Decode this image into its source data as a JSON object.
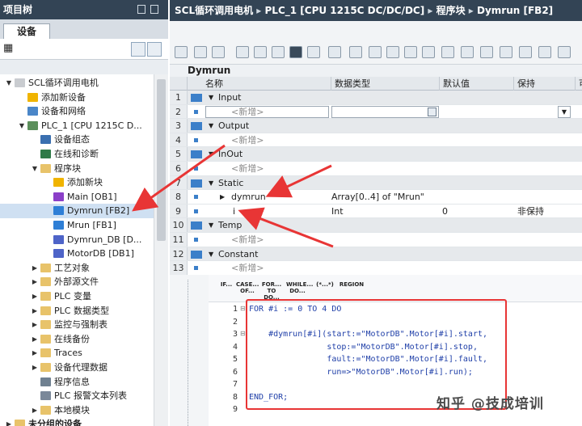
{
  "left_pane": {
    "title": "项目树",
    "tab": "设备"
  },
  "tree": [
    {
      "label": "SCL循环调用电机",
      "depth": 0,
      "expander": "▼",
      "icon": "project-icon"
    },
    {
      "label": "添加新设备",
      "depth": 1,
      "expander": "",
      "icon": "add-device-icon"
    },
    {
      "label": "设备和网络",
      "depth": 1,
      "expander": "",
      "icon": "network-icon"
    },
    {
      "label": "PLC_1 [CPU 1215C D...",
      "depth": 1,
      "expander": "▼",
      "icon": "plc-icon"
    },
    {
      "label": "设备组态",
      "depth": 2,
      "expander": "",
      "icon": "config-icon"
    },
    {
      "label": "在线和诊断",
      "depth": 2,
      "expander": "",
      "icon": "diag-icon"
    },
    {
      "label": "程序块",
      "depth": 2,
      "expander": "▼",
      "icon": "folder-icon"
    },
    {
      "label": "添加新块",
      "depth": 3,
      "expander": "",
      "icon": "add-block-icon"
    },
    {
      "label": "Main [OB1]",
      "depth": 3,
      "expander": "",
      "icon": "ob-icon"
    },
    {
      "label": "Dymrun [FB2]",
      "depth": 3,
      "expander": "",
      "icon": "fb-icon",
      "selected": true
    },
    {
      "label": "Mrun [FB1]",
      "depth": 3,
      "expander": "",
      "icon": "fb-icon"
    },
    {
      "label": "Dymrun_DB [D...",
      "depth": 3,
      "expander": "",
      "icon": "db-icon"
    },
    {
      "label": "MotorDB [DB1]",
      "depth": 3,
      "expander": "",
      "icon": "db-icon"
    },
    {
      "label": "工艺对象",
      "depth": 2,
      "expander": "▶",
      "icon": "folder-icon"
    },
    {
      "label": "外部源文件",
      "depth": 2,
      "expander": "▶",
      "icon": "folder-icon"
    },
    {
      "label": "PLC 变量",
      "depth": 2,
      "expander": "▶",
      "icon": "folder-icon"
    },
    {
      "label": "PLC 数据类型",
      "depth": 2,
      "expander": "▶",
      "icon": "folder-icon"
    },
    {
      "label": "监控与强制表",
      "depth": 2,
      "expander": "▶",
      "icon": "folder-icon"
    },
    {
      "label": "在线备份",
      "depth": 2,
      "expander": "▶",
      "icon": "folder-icon"
    },
    {
      "label": "Traces",
      "depth": 2,
      "expander": "▶",
      "icon": "folder-icon"
    },
    {
      "label": "设备代理数据",
      "depth": 2,
      "expander": "▶",
      "icon": "folder-icon"
    },
    {
      "label": "程序信息",
      "depth": 2,
      "expander": "",
      "icon": "info-icon"
    },
    {
      "label": "PLC 报警文本列表",
      "depth": 2,
      "expander": "",
      "icon": "alarm-icon"
    },
    {
      "label": "本地模块",
      "depth": 2,
      "expander": "▶",
      "icon": "folder-icon"
    },
    {
      "label": "未分组的设备",
      "depth": 0,
      "expander": "▶",
      "icon": "folder-icon"
    }
  ],
  "breadcrumb": [
    "SCL循环调用电机",
    "PLC_1 [CPU 1215C DC/DC/DC]",
    "程序块",
    "Dymrun [FB2]"
  ],
  "breadcrumb_sep": "▸",
  "block_name": "Dymrun",
  "table": {
    "columns": [
      "名称",
      "数据类型",
      "默认值",
      "保持",
      "可"
    ],
    "rows": [
      {
        "num": "1",
        "section": true,
        "expander": "▼",
        "name": "Input",
        "type": "",
        "def": "",
        "ret": ""
      },
      {
        "num": "2",
        "section": false,
        "placeholder": true,
        "name": "<新增>",
        "type": "",
        "def": "",
        "ret": ""
      },
      {
        "num": "3",
        "section": true,
        "expander": "▼",
        "name": "Output",
        "type": "",
        "def": "",
        "ret": ""
      },
      {
        "num": "4",
        "section": false,
        "placeholder": true,
        "name": "<新增>",
        "type": "",
        "def": "",
        "ret": ""
      },
      {
        "num": "5",
        "section": true,
        "expander": "▼",
        "name": "InOut",
        "type": "",
        "def": "",
        "ret": ""
      },
      {
        "num": "6",
        "section": false,
        "placeholder": true,
        "name": "<新增>",
        "type": "",
        "def": "",
        "ret": ""
      },
      {
        "num": "7",
        "section": true,
        "expander": "▼",
        "name": "Static",
        "type": "",
        "def": "",
        "ret": ""
      },
      {
        "num": "8",
        "section": false,
        "expander": "▶",
        "name": "dymrun",
        "type": "Array[0..4] of \"Mrun\"",
        "def": "",
        "ret": ""
      },
      {
        "num": "9",
        "section": false,
        "name": "i",
        "type": "Int",
        "def": "0",
        "ret": "非保持"
      },
      {
        "num": "10",
        "section": true,
        "expander": "▼",
        "name": "Temp",
        "type": "",
        "def": "",
        "ret": ""
      },
      {
        "num": "11",
        "section": false,
        "placeholder": true,
        "name": "<新增>",
        "type": "",
        "def": "",
        "ret": ""
      },
      {
        "num": "12",
        "section": true,
        "expander": "▼",
        "name": "Constant",
        "type": "",
        "def": "",
        "ret": ""
      },
      {
        "num": "13",
        "section": false,
        "placeholder": true,
        "name": "<新增>",
        "type": "",
        "def": "",
        "ret": ""
      }
    ]
  },
  "code_toolbar": [
    {
      "label": "IF...",
      "name": "if-snippet-button"
    },
    {
      "label": "CASE... OF...",
      "name": "case-snippet-button"
    },
    {
      "label": "FOR... TO DO...",
      "name": "for-snippet-button"
    },
    {
      "label": "WHILE... DO...",
      "name": "while-snippet-button"
    },
    {
      "label": "(*...*)",
      "name": "comment-snippet-button"
    },
    {
      "label": "REGION",
      "name": "region-snippet-button"
    }
  ],
  "code": [
    {
      "n": "1",
      "fold": "⊟",
      "text": "FOR #i := 0 TO 4 DO"
    },
    {
      "n": "2",
      "fold": "",
      "text": ""
    },
    {
      "n": "3",
      "fold": "⊟",
      "text": "    #dymrun[#i](start:=\"MotorDB\".Motor[#i].start,"
    },
    {
      "n": "4",
      "fold": "",
      "text": "                stop:=\"MotorDB\".Motor[#i].stop,"
    },
    {
      "n": "5",
      "fold": "",
      "text": "                fault:=\"MotorDB\".Motor[#i].fault,"
    },
    {
      "n": "6",
      "fold": "",
      "text": "                run=>\"MotorDB\".Motor[#i].run);"
    },
    {
      "n": "7",
      "fold": "",
      "text": ""
    },
    {
      "n": "8",
      "fold": "",
      "text": "END_FOR;"
    },
    {
      "n": "9",
      "fold": "",
      "text": ""
    }
  ],
  "watermark": "知乎 @技成培训",
  "colors": {
    "title_bar": "#334455",
    "annotation_red": "#e83535",
    "code_blue": "#1f3fa8"
  }
}
